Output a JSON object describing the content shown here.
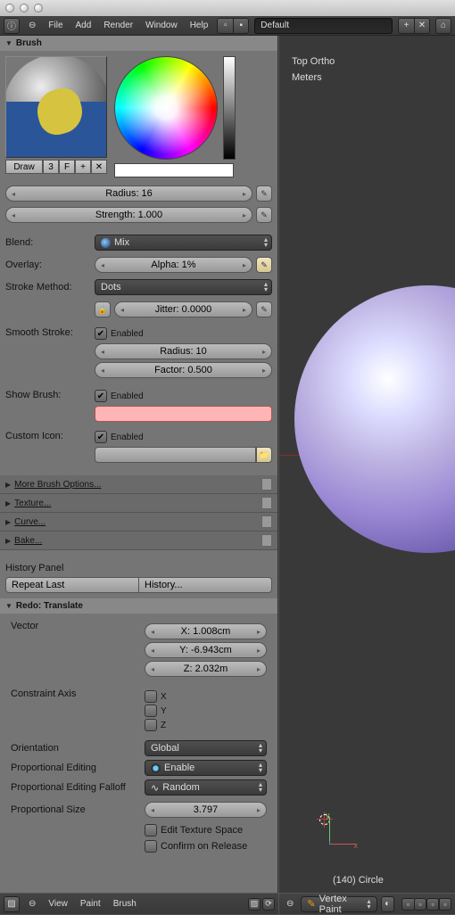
{
  "titlebar": {
    "title": ""
  },
  "topmenu": {
    "items": [
      "File",
      "Add",
      "Render",
      "Window",
      "Help"
    ],
    "scene": "Default"
  },
  "brush_panel_title": "Brush",
  "brush": {
    "row_labels": {
      "draw": "Draw",
      "users": "3",
      "fake": "F"
    },
    "radius": "Radius: 16",
    "strength": "Strength: 1.000",
    "blend": {
      "label": "Blend:",
      "value": "Mix"
    },
    "overlay": {
      "label": "Overlay:",
      "value": "Alpha: 1%"
    },
    "stroke": {
      "label": "Stroke Method:",
      "value": "Dots"
    },
    "jitter": "Jitter: 0.0000",
    "smooth": {
      "label": "Smooth Stroke:",
      "enabled": "Enabled",
      "radius": "Radius: 10",
      "factor": "Factor: 0.500"
    },
    "showbrush": {
      "label": "Show Brush:",
      "enabled": "Enabled"
    },
    "custom": {
      "label": "Custom Icon:",
      "enabled": "Enabled"
    }
  },
  "collapsed": {
    "more": "More Brush Options...",
    "texture": "Texture...",
    "curve": "Curve...",
    "bake": "Bake..."
  },
  "history": {
    "title": "History Panel",
    "repeat": "Repeat Last",
    "hist": "History..."
  },
  "redo": {
    "title": "Redo: Translate",
    "vector": "Vector",
    "x": "X: 1.008cm",
    "y": "Y: -6.943cm",
    "z": "Z: 2.032m",
    "constraint": "Constraint Axis",
    "cx": "X",
    "cy": "Y",
    "cz": "Z",
    "orientation_label": "Orientation",
    "orientation": "Global",
    "propedit_label": "Proportional Editing",
    "propedit": "Enable",
    "falloff_label": "Proportional Editing Falloff",
    "falloff": "Random",
    "size_label": "Proportional Size",
    "size": "3.797",
    "texspace": "Edit Texture Space",
    "confirm": "Confirm on Release"
  },
  "viewport": {
    "view": "Top Ortho",
    "units": "Meters",
    "object": "(140) Circle"
  },
  "bottombar": {
    "left": [
      "View",
      "Paint",
      "Brush"
    ],
    "mode": "Vertex Paint"
  }
}
